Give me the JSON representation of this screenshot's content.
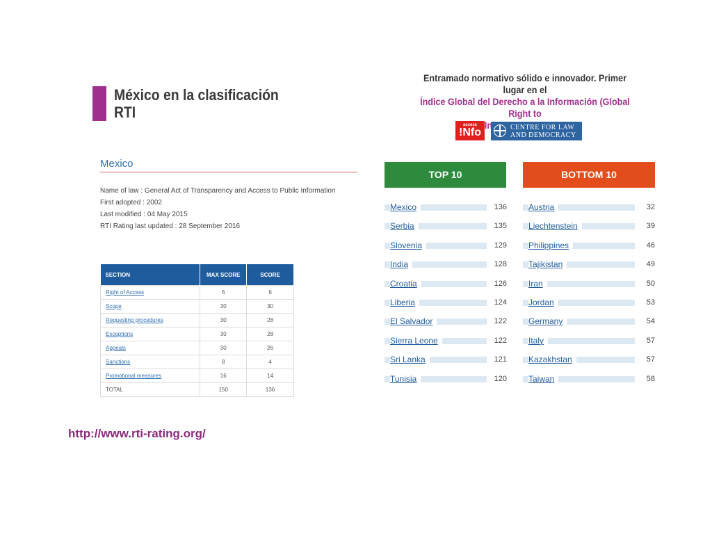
{
  "slide": {
    "title_line1": "México en la clasificación",
    "title_line2": "RTI",
    "headline_line1": "Entramado normativo sólido e innovador. Primer lugar en el",
    "headline_line2": "Índice Global del Derecho a la Información (Global Right to",
    "headline_line3": "Information Rating)",
    "url": "http://www.rti-rating.org/"
  },
  "logos": {
    "access_small": "access",
    "access_big": "!Nfo",
    "cld_line1": "CENTRE FOR LAW",
    "cld_line2": "AND DEMOCRACY"
  },
  "country": {
    "heading": "Mexico",
    "name_of_law": "Name of law : General Act of Transparency and Access to Public Information",
    "first_adopted": "First adopted : 2002",
    "last_modified": "Last modified : 04 May 2015",
    "rating_updated": "RTI Rating last updated : 28 September 2016"
  },
  "score_table": {
    "headers": [
      "SECTION",
      "MAX SCORE",
      "SCORE"
    ],
    "rows": [
      {
        "section": "Right of Access",
        "max": "6",
        "score": "6"
      },
      {
        "section": "Scope",
        "max": "30",
        "score": "30"
      },
      {
        "section": "Requesting procedures",
        "max": "30",
        "score": "28"
      },
      {
        "section": "Exceptions",
        "max": "30",
        "score": "28"
      },
      {
        "section": "Appeals",
        "max": "30",
        "score": "26"
      },
      {
        "section": "Sanctions",
        "max": "8",
        "score": "4"
      },
      {
        "section": "Promotional measures",
        "max": "16",
        "score": "14"
      }
    ],
    "total": {
      "section": "TOTAL",
      "max": "150",
      "score": "136"
    }
  },
  "top10": {
    "label": "TOP 10",
    "items": [
      {
        "country": "Mexico",
        "score": 136
      },
      {
        "country": "Serbia",
        "score": 135
      },
      {
        "country": "Slovenia",
        "score": 129
      },
      {
        "country": "India",
        "score": 128
      },
      {
        "country": "Croatia",
        "score": 126
      },
      {
        "country": "Liberia",
        "score": 124
      },
      {
        "country": "El Salvador",
        "score": 122
      },
      {
        "country": "Sierra Leone",
        "score": 122
      },
      {
        "country": "Sri Lanka",
        "score": 121
      },
      {
        "country": "Tunisia",
        "score": 120
      }
    ]
  },
  "bottom10": {
    "label": "BOTTOM 10",
    "items": [
      {
        "country": "Austria",
        "score": 32
      },
      {
        "country": "Liechtenstein",
        "score": 39
      },
      {
        "country": "Philippines",
        "score": 46
      },
      {
        "country": "Tajikistan",
        "score": 49
      },
      {
        "country": "Iran",
        "score": 50
      },
      {
        "country": "Jordan",
        "score": 53
      },
      {
        "country": "Germany",
        "score": 54
      },
      {
        "country": "Italy",
        "score": 57
      },
      {
        "country": "Kazakhstan",
        "score": 57
      },
      {
        "country": "Taiwan",
        "score": 58
      }
    ]
  },
  "colors": {
    "accent_purple": "#a0308e",
    "top_green": "#2e8b3d",
    "bottom_orange": "#e24d1b",
    "table_blue": "#1f5c9e"
  }
}
